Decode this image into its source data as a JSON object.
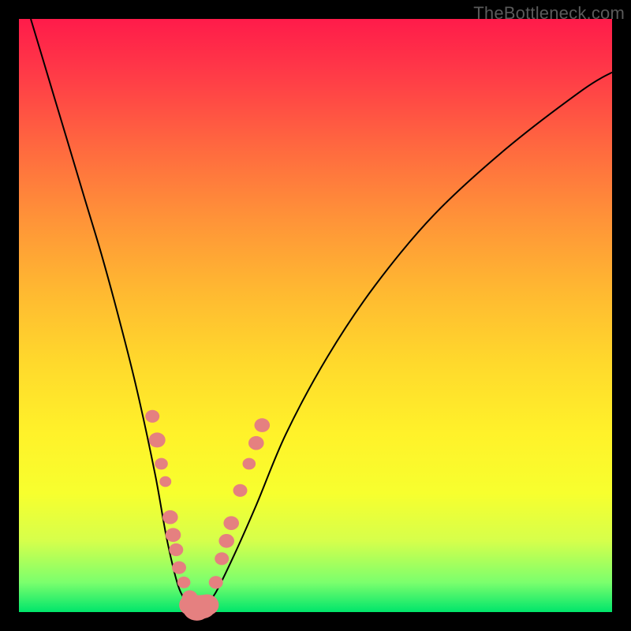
{
  "watermark": "TheBottleneck.com",
  "colors": {
    "frame": "#000000",
    "curve": "#000000",
    "markers": "#e58080",
    "gradient_stops": [
      "#ff1b4a",
      "#ff3d47",
      "#ff6a3f",
      "#ff9438",
      "#ffb931",
      "#ffd92c",
      "#fff22a",
      "#f7ff2e",
      "#d6ff4b",
      "#7bff6d",
      "#00e56b"
    ]
  },
  "chart_data": {
    "type": "line",
    "title": "",
    "xlabel": "",
    "ylabel": "",
    "xlim": [
      0,
      100
    ],
    "ylim": [
      0,
      100
    ],
    "series": [
      {
        "name": "bottleneck-curve",
        "x": [
          2,
          5,
          8,
          11,
          14,
          17,
          20,
          23,
          25,
          27,
          29,
          30,
          31,
          33,
          36,
          40,
          45,
          52,
          60,
          70,
          82,
          95,
          100
        ],
        "y": [
          100,
          90,
          80,
          70,
          60,
          49,
          37,
          23,
          12,
          4,
          1,
          0.5,
          1,
          3,
          9,
          18,
          30,
          43,
          55,
          67,
          78,
          88,
          91
        ]
      }
    ],
    "markers": {
      "name": "highlighted-points",
      "points": [
        {
          "x": 22.5,
          "y": 33,
          "r": 1.2
        },
        {
          "x": 23.3,
          "y": 29,
          "r": 1.4
        },
        {
          "x": 24.0,
          "y": 25,
          "r": 1.1
        },
        {
          "x": 24.7,
          "y": 22,
          "r": 1.0
        },
        {
          "x": 25.5,
          "y": 16,
          "r": 1.3
        },
        {
          "x": 26.0,
          "y": 13,
          "r": 1.3
        },
        {
          "x": 26.5,
          "y": 10.5,
          "r": 1.2
        },
        {
          "x": 27.0,
          "y": 7.5,
          "r": 1.2
        },
        {
          "x": 27.8,
          "y": 5.0,
          "r": 1.1
        },
        {
          "x": 28.8,
          "y": 2.5,
          "r": 1.3
        },
        {
          "x": 29.0,
          "y": 1.2,
          "r": 2.0
        },
        {
          "x": 30.0,
          "y": 0.7,
          "r": 2.4
        },
        {
          "x": 31.0,
          "y": 0.9,
          "r": 2.2
        },
        {
          "x": 31.7,
          "y": 1.2,
          "r": 2.0
        },
        {
          "x": 33.2,
          "y": 5.0,
          "r": 1.2
        },
        {
          "x": 34.2,
          "y": 9.0,
          "r": 1.2
        },
        {
          "x": 35.0,
          "y": 12.0,
          "r": 1.3
        },
        {
          "x": 35.8,
          "y": 15.0,
          "r": 1.3
        },
        {
          "x": 37.3,
          "y": 20.5,
          "r": 1.2
        },
        {
          "x": 38.8,
          "y": 25,
          "r": 1.1
        },
        {
          "x": 40.0,
          "y": 28.5,
          "r": 1.3
        },
        {
          "x": 41.0,
          "y": 31.5,
          "r": 1.3
        }
      ]
    }
  }
}
